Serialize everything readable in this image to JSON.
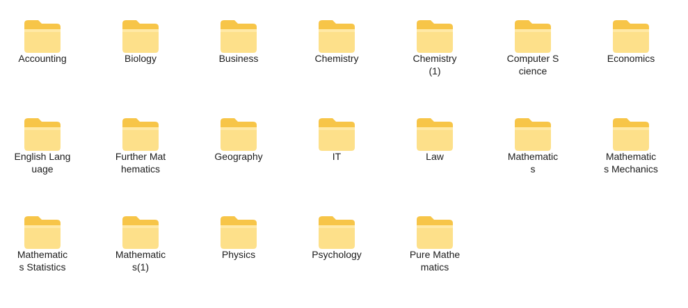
{
  "folders": [
    {
      "name": "Accounting"
    },
    {
      "name": "Biology"
    },
    {
      "name": "Business"
    },
    {
      "name": "Chemistry"
    },
    {
      "name": "Chemistry\n(1)"
    },
    {
      "name": "Computer S\ncience"
    },
    {
      "name": "Economics"
    },
    {
      "name": "English Lang\nuage"
    },
    {
      "name": "Further Mat\nhematics"
    },
    {
      "name": "Geography"
    },
    {
      "name": "IT"
    },
    {
      "name": "Law"
    },
    {
      "name": "Mathematic\ns"
    },
    {
      "name": "Mathematic\ns Mechanics"
    },
    {
      "name": "Mathematic\ns Statistics"
    },
    {
      "name": "Mathematic\ns(1)"
    },
    {
      "name": "Physics"
    },
    {
      "name": "Psychology"
    },
    {
      "name": "Pure Mathe\nmatics"
    }
  ],
  "icon": "folder-icon",
  "colors": {
    "folder_back": "#f7c548",
    "folder_front": "#fde08a",
    "folder_front_light": "#ffe9a6"
  }
}
